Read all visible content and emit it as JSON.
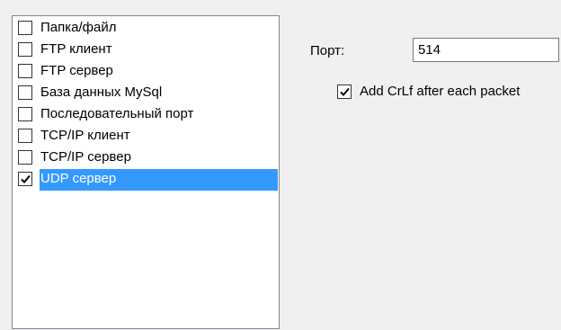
{
  "list": {
    "items": [
      {
        "label": "Папка/файл",
        "checked": false,
        "selected": false
      },
      {
        "label": "FTP клиент",
        "checked": false,
        "selected": false
      },
      {
        "label": "FTP сервер",
        "checked": false,
        "selected": false
      },
      {
        "label": "База данных MySql",
        "checked": false,
        "selected": false
      },
      {
        "label": "Последовательный порт",
        "checked": false,
        "selected": false
      },
      {
        "label": "TCP/IP клиент",
        "checked": false,
        "selected": false
      },
      {
        "label": "TCP/IP сервер",
        "checked": false,
        "selected": false
      },
      {
        "label": "UDP сервер",
        "checked": true,
        "selected": true
      }
    ]
  },
  "settings": {
    "port_label": "Порт:",
    "port_value": "514",
    "crlf_label": "Add CrLf after each packet",
    "crlf_checked": true
  },
  "colors": {
    "selection": "#3399ff",
    "background": "#f0f0f0"
  }
}
